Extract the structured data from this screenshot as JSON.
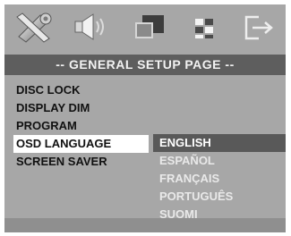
{
  "icons": [
    "tools-icon",
    "speaker-icon",
    "video-icon",
    "preference-icon",
    "exit-icon"
  ],
  "title": "-- GENERAL SETUP PAGE --",
  "menu": {
    "items": [
      {
        "label": "DISC LOCK"
      },
      {
        "label": "DISPLAY DIM"
      },
      {
        "label": "PROGRAM"
      },
      {
        "label": "OSD LANGUAGE",
        "selected": true
      },
      {
        "label": "SCREEN SAVER"
      }
    ]
  },
  "language_options": {
    "items": [
      {
        "label": "ENGLISH",
        "selected": true
      },
      {
        "label": "ESPAÑOL"
      },
      {
        "label": "FRANÇAIS"
      },
      {
        "label": "PORTUGUÊS"
      },
      {
        "label": "SUOMI"
      }
    ]
  },
  "colors": {
    "background": "#a7a7a7",
    "title_bar": "#5e5e5e",
    "menu_highlight": "#ffffff",
    "option_highlight": "#595959"
  }
}
